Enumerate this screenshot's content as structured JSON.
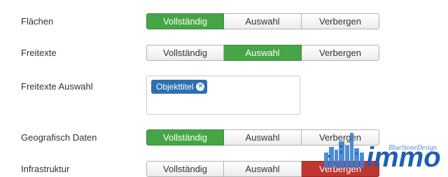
{
  "rows": [
    {
      "label": "Flächen",
      "options": [
        "Vollständig",
        "Auswahl",
        "Verbergen"
      ],
      "selected": 0
    },
    {
      "label": "Freitexte",
      "options": [
        "Vollständig",
        "Auswahl",
        "Verbergen"
      ],
      "selected": 1
    },
    {
      "label": "Freitexte Auswahl",
      "chips": [
        "Objekttitel"
      ]
    },
    {
      "label": "Geografisch Daten",
      "options": [
        "Vollständig",
        "Auswahl",
        "Verbergen"
      ],
      "selected": 0
    },
    {
      "label": "Infrastruktur",
      "options": [
        "Vollständig",
        "Auswahl",
        "Verbergen"
      ],
      "selected": 2
    }
  ],
  "watermark": {
    "logo_text": "immo",
    "tagline": "BlueStoneDesign"
  },
  "colors": {
    "active": "#46a546",
    "danger": "#bd362f",
    "chip": "#2f6fb0"
  }
}
